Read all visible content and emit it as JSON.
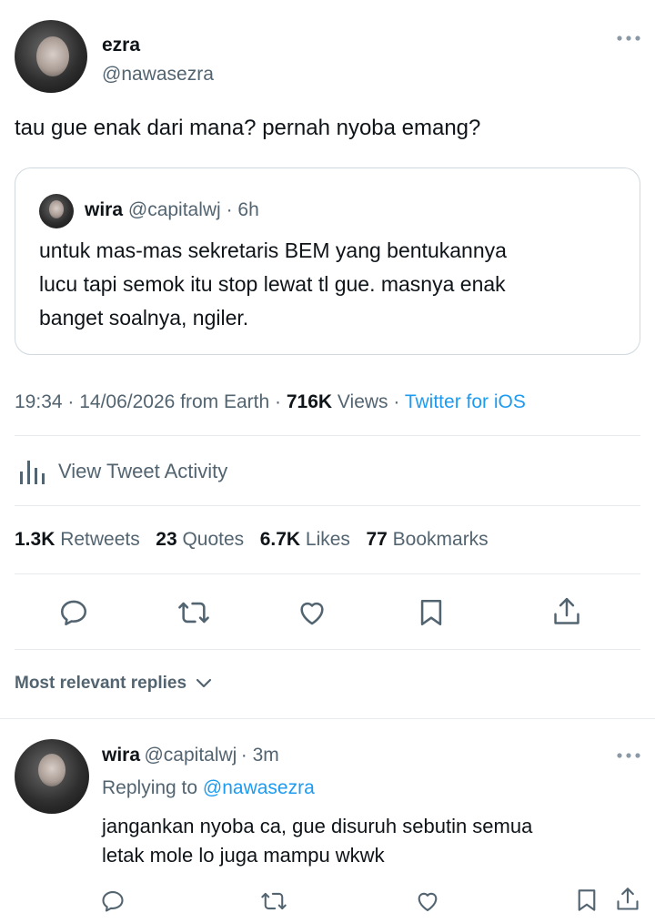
{
  "tweet": {
    "author_name": "ezra",
    "author_handle": "@nawasezra",
    "text": "tau gue enak dari mana? pernah nyoba emang?",
    "more_icon": "more-horizontal-icon"
  },
  "quote": {
    "author_name": "wira",
    "author_handle": "@capitalwj",
    "time": "· 6h",
    "lines": [
      "untuk mas-mas sekretaris BEM yang bentukannya",
      "lucu tapi semok itu stop lewat tl gue. masnya enak",
      "banget soalnya, ngiler."
    ]
  },
  "meta": {
    "time": "19:34 · 14/06/2026 from Earth ·",
    "views_count": "716K",
    "views_label": "Views ·",
    "source": "Twitter for iOS"
  },
  "activity": {
    "label": "View Tweet Activity",
    "icon": "bar-chart-icon"
  },
  "stats": {
    "retweets_count": "1.3K",
    "retweets_label": "Retweets",
    "quotes_count": "23",
    "quotes_label": "Quotes",
    "likes_count": "6.7K",
    "likes_label": "Likes",
    "bookmarks_count": "77",
    "bookmarks_label": "Bookmarks"
  },
  "actions": [
    "reply-icon",
    "retweet-icon",
    "like-icon",
    "bookmark-icon",
    "share-icon"
  ],
  "replies_filter": {
    "label": "Most relevant replies",
    "icon": "chevron-down-icon"
  },
  "reply": {
    "author_name": "wira",
    "author_handle": "@capitalwj",
    "time": "· 3m",
    "replying_to_label": "Replying to",
    "replying_to_handle": "@nawasezra",
    "lines": [
      "jangankan nyoba ca, gue disuruh sebutin semua",
      "letak mole lo juga mampu wkwk"
    ]
  },
  "colors": {
    "accent": "#1d9bf0",
    "secondary_text": "#536471",
    "primary_text": "#0f1419",
    "divider": "#e7ebee"
  }
}
